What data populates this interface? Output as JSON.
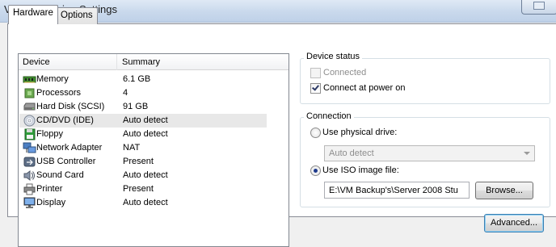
{
  "window": {
    "title": "Virtual Machine Settings"
  },
  "tabs": [
    {
      "label": "Hardware",
      "active": true
    },
    {
      "label": "Options",
      "active": false
    }
  ],
  "device_list": {
    "columns": [
      "Device",
      "Summary"
    ],
    "rows": [
      {
        "icon": "memory-icon",
        "name": "Memory",
        "summary": "6.1 GB"
      },
      {
        "icon": "processor-icon",
        "name": "Processors",
        "summary": "4"
      },
      {
        "icon": "hard-disk-icon",
        "name": "Hard Disk (SCSI)",
        "summary": "91 GB"
      },
      {
        "icon": "cd-dvd-icon",
        "name": "CD/DVD (IDE)",
        "summary": "Auto detect",
        "selected": true
      },
      {
        "icon": "floppy-icon",
        "name": "Floppy",
        "summary": "Auto detect"
      },
      {
        "icon": "network-adapter-icon",
        "name": "Network Adapter",
        "summary": "NAT"
      },
      {
        "icon": "usb-controller-icon",
        "name": "USB Controller",
        "summary": "Present"
      },
      {
        "icon": "sound-card-icon",
        "name": "Sound Card",
        "summary": "Auto detect"
      },
      {
        "icon": "printer-icon",
        "name": "Printer",
        "summary": "Present"
      },
      {
        "icon": "display-icon",
        "name": "Display",
        "summary": "Auto detect"
      }
    ]
  },
  "device_status": {
    "title": "Device status",
    "connected": {
      "label": "Connected",
      "checked": false,
      "enabled": false
    },
    "connect_at_power_on": {
      "label": "Connect at power on",
      "checked": true,
      "enabled": true
    }
  },
  "connection": {
    "title": "Connection",
    "use_physical_drive": {
      "label": "Use physical drive:",
      "selected": false
    },
    "physical_drive_value": "Auto detect",
    "use_iso_image": {
      "label": "Use ISO image file:",
      "selected": true
    },
    "iso_path": "E:\\VM Backup's\\Server 2008 Stu",
    "browse_label": "Browse..."
  },
  "advanced_label": "Advanced...",
  "colors": {
    "titlebar": "#c9d9ec",
    "selection": "#e8e8e8",
    "radio_dot": "#1e3a8c"
  }
}
